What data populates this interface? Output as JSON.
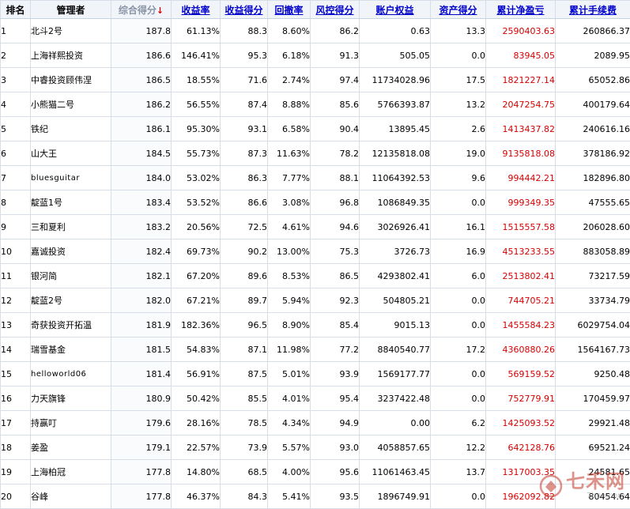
{
  "columns": [
    {
      "key": "rank",
      "label": "排名",
      "style": "plain"
    },
    {
      "key": "manager",
      "label": "管理者",
      "style": "plain"
    },
    {
      "key": "composite",
      "label": "综合得分",
      "style": "sorted",
      "sort_arrow": "↓"
    },
    {
      "key": "return_rate",
      "label": "收益率",
      "style": "sortable"
    },
    {
      "key": "return_score",
      "label": "收益得分",
      "style": "sortable"
    },
    {
      "key": "drawdown",
      "label": "回撤率",
      "style": "sortable"
    },
    {
      "key": "risk_score",
      "label": "风控得分",
      "style": "sortable"
    },
    {
      "key": "equity",
      "label": "账户权益",
      "style": "sortable"
    },
    {
      "key": "asset_score",
      "label": "资产得分",
      "style": "sortable"
    },
    {
      "key": "net_profit",
      "label": "累计净盈亏",
      "style": "sortable"
    },
    {
      "key": "fees",
      "label": "累计手续费",
      "style": "sortable"
    }
  ],
  "rows": [
    {
      "rank": "1",
      "manager": "北斗2号",
      "composite": "187.8",
      "return_rate": "61.13%",
      "return_score": "88.3",
      "drawdown": "8.60%",
      "risk_score": "86.2",
      "equity": "0.63",
      "asset_score": "13.3",
      "net_profit": "2590403.63",
      "fees": "260866.37"
    },
    {
      "rank": "2",
      "manager": "上海祥熙投资",
      "composite": "186.6",
      "return_rate": "146.41%",
      "return_score": "95.3",
      "drawdown": "6.18%",
      "risk_score": "91.3",
      "equity": "505.05",
      "asset_score": "0.0",
      "net_profit": "83945.05",
      "fees": "2089.95"
    },
    {
      "rank": "3",
      "manager": "中睿投资顾伟涅",
      "composite": "186.5",
      "return_rate": "18.55%",
      "return_score": "71.6",
      "drawdown": "2.74%",
      "risk_score": "97.4",
      "equity": "11734028.96",
      "asset_score": "17.5",
      "net_profit": "1821227.14",
      "fees": "65052.86"
    },
    {
      "rank": "4",
      "manager": "小熊猫二号",
      "composite": "186.2",
      "return_rate": "56.55%",
      "return_score": "87.4",
      "drawdown": "8.88%",
      "risk_score": "85.6",
      "equity": "5766393.87",
      "asset_score": "13.2",
      "net_profit": "2047254.75",
      "fees": "400179.64"
    },
    {
      "rank": "5",
      "manager": "铁纪",
      "composite": "186.1",
      "return_rate": "95.30%",
      "return_score": "93.1",
      "drawdown": "6.58%",
      "risk_score": "90.4",
      "equity": "13895.45",
      "asset_score": "2.6",
      "net_profit": "1413437.82",
      "fees": "240616.16"
    },
    {
      "rank": "6",
      "manager": "山大王",
      "composite": "184.5",
      "return_rate": "55.73%",
      "return_score": "87.3",
      "drawdown": "11.63%",
      "risk_score": "78.2",
      "equity": "12135818.08",
      "asset_score": "19.0",
      "net_profit": "9135818.08",
      "fees": "378186.92"
    },
    {
      "rank": "7",
      "manager": "bluesguitar",
      "composite": "184.0",
      "return_rate": "53.02%",
      "return_score": "86.3",
      "drawdown": "7.77%",
      "risk_score": "88.1",
      "equity": "11064392.53",
      "asset_score": "9.6",
      "net_profit": "994442.21",
      "fees": "182896.80"
    },
    {
      "rank": "8",
      "manager": "靛蓝1号",
      "composite": "183.4",
      "return_rate": "53.52%",
      "return_score": "86.6",
      "drawdown": "3.08%",
      "risk_score": "96.8",
      "equity": "1086849.35",
      "asset_score": "0.0",
      "net_profit": "999349.35",
      "fees": "47555.65"
    },
    {
      "rank": "9",
      "manager": "三和夏利",
      "composite": "183.2",
      "return_rate": "20.56%",
      "return_score": "72.5",
      "drawdown": "4.61%",
      "risk_score": "94.6",
      "equity": "3026926.41",
      "asset_score": "16.1",
      "net_profit": "1515557.58",
      "fees": "206028.60"
    },
    {
      "rank": "10",
      "manager": "嘉诚投资",
      "composite": "182.4",
      "return_rate": "69.73%",
      "return_score": "90.2",
      "drawdown": "13.00%",
      "risk_score": "75.3",
      "equity": "3726.73",
      "asset_score": "16.9",
      "net_profit": "4513233.55",
      "fees": "883058.89"
    },
    {
      "rank": "11",
      "manager": "银河简",
      "composite": "182.1",
      "return_rate": "67.20%",
      "return_score": "89.6",
      "drawdown": "8.53%",
      "risk_score": "86.5",
      "equity": "4293802.41",
      "asset_score": "6.0",
      "net_profit": "2513802.41",
      "fees": "73217.59"
    },
    {
      "rank": "12",
      "manager": "靛蓝2号",
      "composite": "182.0",
      "return_rate": "67.21%",
      "return_score": "89.7",
      "drawdown": "5.94%",
      "risk_score": "92.3",
      "equity": "504805.21",
      "asset_score": "0.0",
      "net_profit": "744705.21",
      "fees": "33734.79"
    },
    {
      "rank": "13",
      "manager": "奇获投资开拓温",
      "composite": "181.9",
      "return_rate": "182.36%",
      "return_score": "96.5",
      "drawdown": "8.90%",
      "risk_score": "85.4",
      "equity": "9015.13",
      "asset_score": "0.0",
      "net_profit": "1455584.23",
      "fees": "6029754.04"
    },
    {
      "rank": "14",
      "manager": "瑞雪基金",
      "composite": "181.5",
      "return_rate": "54.83%",
      "return_score": "87.1",
      "drawdown": "11.98%",
      "risk_score": "77.2",
      "equity": "8840540.77",
      "asset_score": "17.2",
      "net_profit": "4360880.26",
      "fees": "1564167.73"
    },
    {
      "rank": "15",
      "manager": "helloworld06",
      "composite": "181.4",
      "return_rate": "56.91%",
      "return_score": "87.5",
      "drawdown": "5.01%",
      "risk_score": "93.9",
      "equity": "1569177.77",
      "asset_score": "0.0",
      "net_profit": "569159.52",
      "fees": "9250.48"
    },
    {
      "rank": "16",
      "manager": "力天旗锋",
      "composite": "180.9",
      "return_rate": "50.42%",
      "return_score": "85.5",
      "drawdown": "4.01%",
      "risk_score": "95.4",
      "equity": "3237422.48",
      "asset_score": "0.0",
      "net_profit": "752779.91",
      "fees": "170459.97"
    },
    {
      "rank": "17",
      "manager": "持赢叮",
      "composite": "179.6",
      "return_rate": "28.16%",
      "return_score": "78.5",
      "drawdown": "4.34%",
      "risk_score": "94.9",
      "equity": "0.00",
      "asset_score": "6.2",
      "net_profit": "1425093.52",
      "fees": "29921.48"
    },
    {
      "rank": "18",
      "manager": "姜盈",
      "composite": "179.1",
      "return_rate": "22.57%",
      "return_score": "73.9",
      "drawdown": "5.57%",
      "risk_score": "93.0",
      "equity": "4058857.65",
      "asset_score": "12.2",
      "net_profit": "642128.76",
      "fees": "69521.24"
    },
    {
      "rank": "19",
      "manager": "上海柏冠",
      "composite": "177.8",
      "return_rate": "14.80%",
      "return_score": "68.5",
      "drawdown": "4.00%",
      "risk_score": "95.6",
      "equity": "11061463.45",
      "asset_score": "13.7",
      "net_profit": "1317003.35",
      "fees": "24581.65"
    },
    {
      "rank": "20",
      "manager": "谷峰",
      "composite": "177.8",
      "return_rate": "46.37%",
      "return_score": "84.3",
      "drawdown": "5.41%",
      "risk_score": "93.5",
      "equity": "1896749.91",
      "asset_score": "0.0",
      "net_profit": "1962092.82",
      "fees": "80454.64"
    }
  ],
  "watermark": {
    "name": "七禾网",
    "url": "7hcn.com"
  },
  "colors": {
    "header_bg": "#f1f5fa",
    "link_blue": "#0000cc",
    "profit_red": "#d40000",
    "sort_arrow": "#e00000",
    "grid": "#d7dee8"
  },
  "icons": {
    "sort_indicator": "sort-desc-arrow-icon",
    "watermark_logo": "qihe-logo-icon"
  }
}
